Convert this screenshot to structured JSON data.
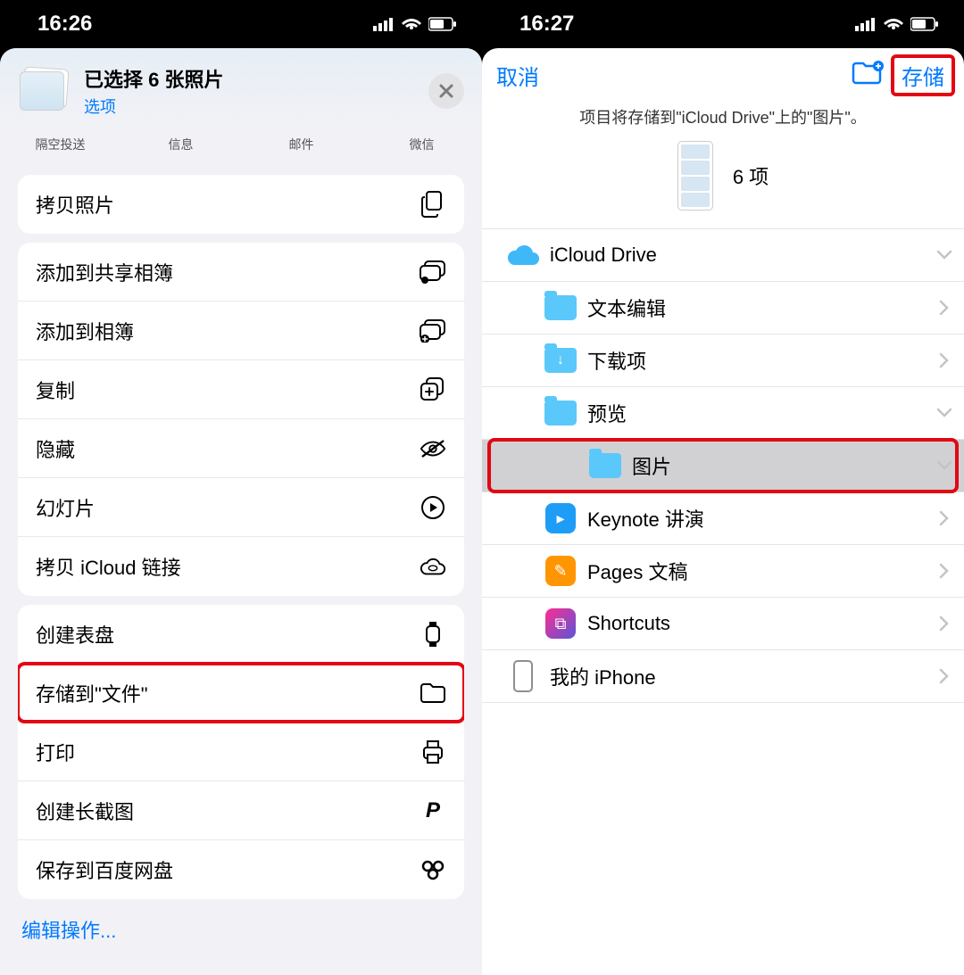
{
  "left": {
    "time": "16:26",
    "share": {
      "title": "已选择 6 张照片",
      "options": "选项",
      "apps": [
        "隔空投送",
        "信息",
        "邮件",
        "微信"
      ]
    },
    "group1": [
      {
        "label": "拷贝照片",
        "icon": "copy-doc"
      }
    ],
    "group2": [
      {
        "label": "添加到共享相簿",
        "icon": "shared-album"
      },
      {
        "label": "添加到相簿",
        "icon": "add-album"
      },
      {
        "label": "复制",
        "icon": "duplicate"
      },
      {
        "label": "隐藏",
        "icon": "hide"
      },
      {
        "label": "幻灯片",
        "icon": "play"
      },
      {
        "label": "拷贝 iCloud 链接",
        "icon": "cloud-link"
      }
    ],
    "group3": [
      {
        "label": "创建表盘",
        "icon": "watch"
      },
      {
        "label": "存储到\"文件\"",
        "icon": "folder",
        "highlight": true
      },
      {
        "label": "打印",
        "icon": "print"
      },
      {
        "label": "创建长截图",
        "icon": "p"
      },
      {
        "label": "保存到百度网盘",
        "icon": "baidu"
      }
    ],
    "edit_ops": "编辑操作..."
  },
  "right": {
    "time": "16:27",
    "cancel": "取消",
    "save": "存储",
    "dest_text": "项目将存储到\"iCloud Drive\"上的\"图片\"。",
    "item_count": "6 项",
    "rows": [
      {
        "label": "iCloud Drive",
        "type": "icloud",
        "indent": 0,
        "chev": "down"
      },
      {
        "label": "文本编辑",
        "type": "folder",
        "indent": 1,
        "chev": "right"
      },
      {
        "label": "下载项",
        "type": "folder-dl",
        "indent": 1,
        "chev": "right"
      },
      {
        "label": "预览",
        "type": "folder",
        "indent": 1,
        "chev": "down"
      },
      {
        "label": "图片",
        "type": "folder",
        "indent": 2,
        "chev": "down",
        "selected": true,
        "highlight": true
      },
      {
        "label": "Keynote 讲演",
        "type": "keynote",
        "indent": 1,
        "chev": "right"
      },
      {
        "label": "Pages 文稿",
        "type": "pages",
        "indent": 1,
        "chev": "right"
      },
      {
        "label": "Shortcuts",
        "type": "shortcuts",
        "indent": 1,
        "chev": "right"
      },
      {
        "label": "我的 iPhone",
        "type": "iphone",
        "indent": 0,
        "chev": "right"
      }
    ]
  }
}
